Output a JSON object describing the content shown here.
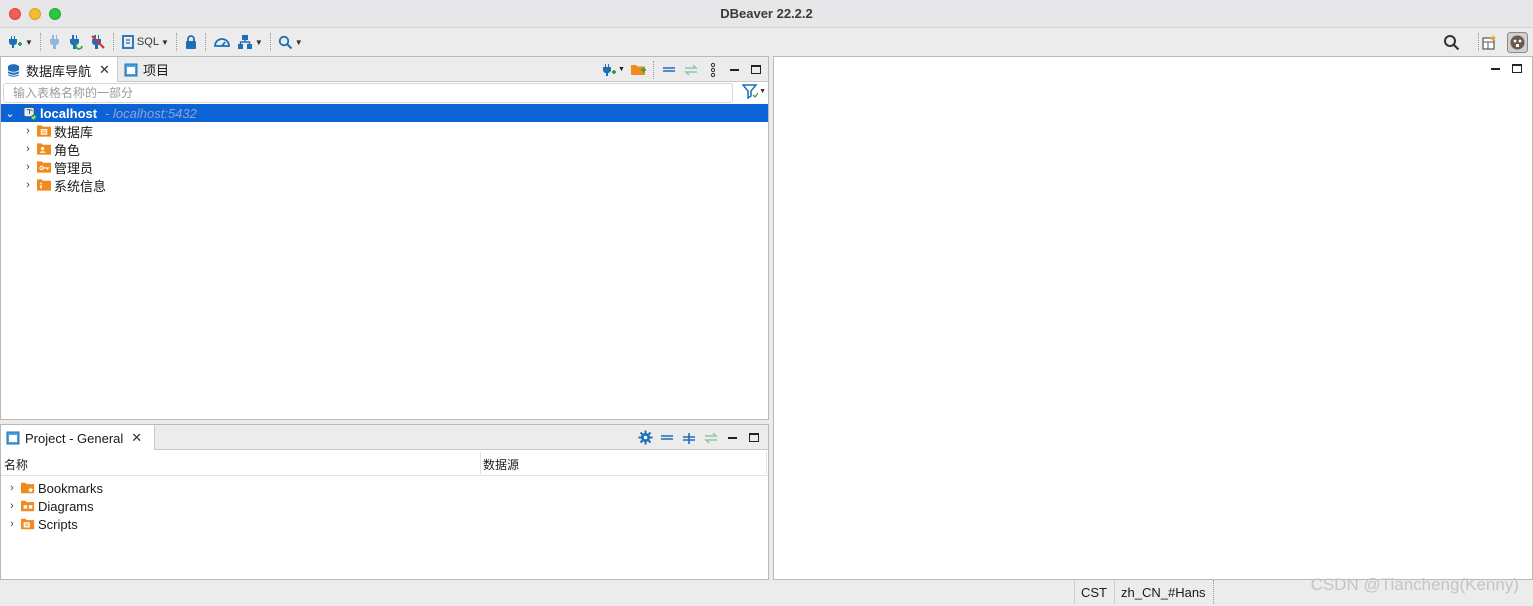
{
  "window": {
    "title": "DBeaver 22.2.2"
  },
  "toolbar": {
    "sql_label": "SQL",
    "icons": [
      "new-connection-icon",
      "connect-icon",
      "reconnect-icon",
      "disconnect-icon",
      "sql-editor-icon",
      "lock-icon",
      "dashboard-icon",
      "navigator-settings-icon",
      "search-icon"
    ]
  },
  "navigator": {
    "tab_label": "数据库导航",
    "filter_placeholder": "输入表格名称的一部分",
    "connection": {
      "label": "localhost",
      "detail": " - localhost:5432"
    },
    "items": [
      {
        "label": "数据库",
        "icon": "database-folder-icon"
      },
      {
        "label": "角色",
        "icon": "roles-folder-icon"
      },
      {
        "label": "管理员",
        "icon": "admin-folder-icon"
      },
      {
        "label": "系统信息",
        "icon": "system-info-folder-icon"
      }
    ]
  },
  "projects_tab": {
    "label": "项目"
  },
  "project_panel": {
    "tab_label": "Project - General",
    "columns": [
      "名称",
      "数据源"
    ],
    "items": [
      {
        "label": "Bookmarks",
        "icon": "bookmarks-folder-icon"
      },
      {
        "label": "Diagrams",
        "icon": "diagrams-folder-icon"
      },
      {
        "label": "Scripts",
        "icon": "scripts-folder-icon"
      }
    ]
  },
  "status": {
    "timezone": "CST",
    "locale": "zh_CN_#Hans"
  },
  "watermark": "CSDN @Tiancheng(Kenny)",
  "colors": {
    "accent": "#0b63d6",
    "folder": "#f08a1c",
    "icon_blue": "#1e6fb8"
  }
}
